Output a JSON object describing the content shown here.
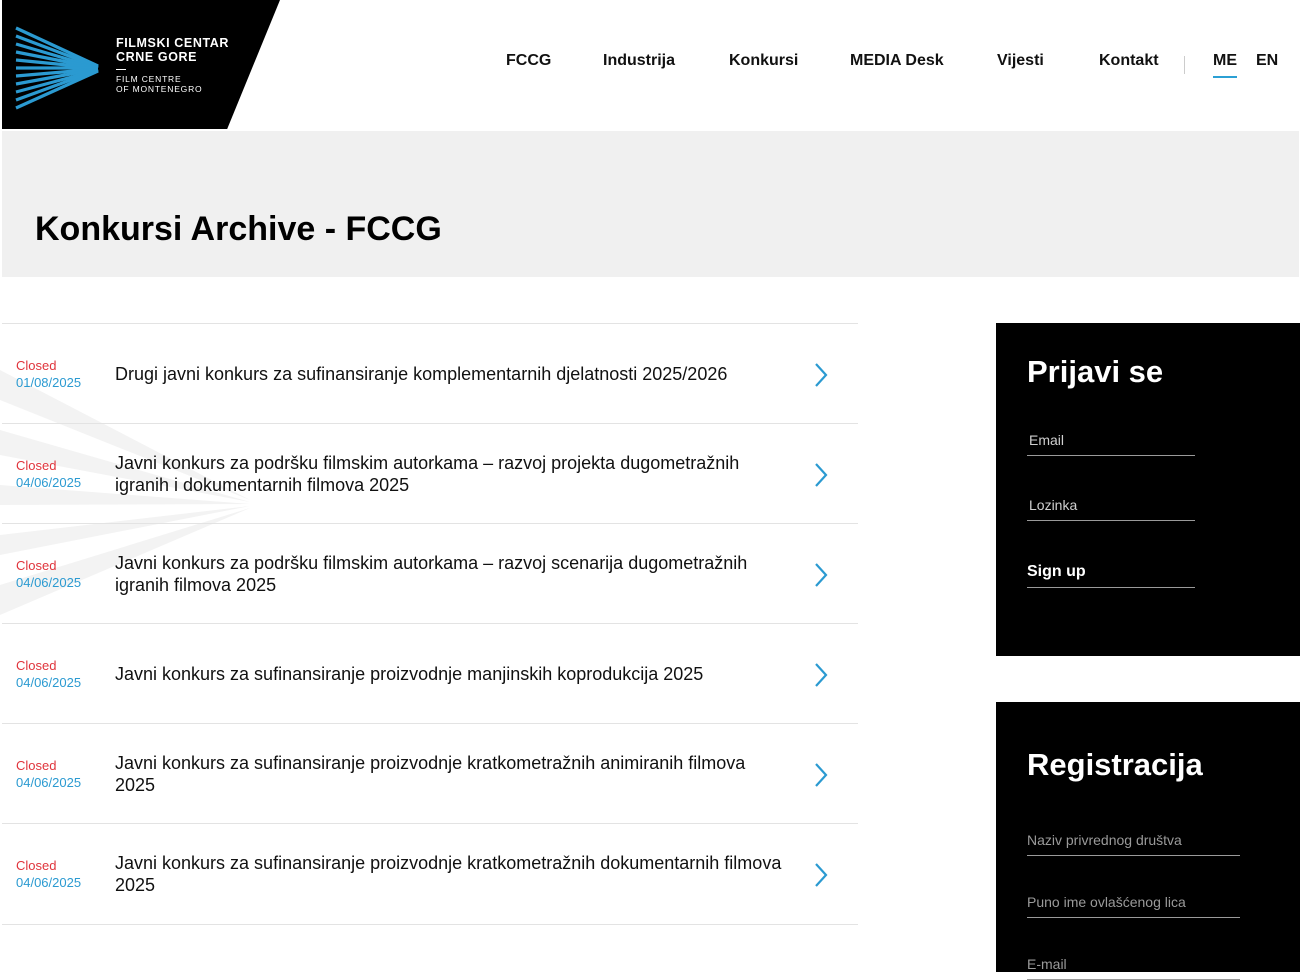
{
  "header": {
    "logo": {
      "line1": "FILMSKI CENTAR",
      "line2": "CRNE GORE",
      "line3": "FILM CENTRE",
      "line4": "OF MONTENEGRO"
    },
    "nav": [
      "FCCG",
      "Industrija",
      "Konkursi",
      "MEDIA Desk",
      "Vijesti",
      "Kontakt"
    ],
    "languages": [
      {
        "code": "ME",
        "active": true
      },
      {
        "code": "EN",
        "active": false
      }
    ]
  },
  "page_title": "Konkursi Archive - FCCG",
  "calls": [
    {
      "status": "Closed",
      "date": "01/08/2025",
      "title": "Drugi javni konkurs za sufinansiranje komplementarnih djelatnosti 2025/2026"
    },
    {
      "status": "Closed",
      "date": "04/06/2025",
      "title": "Javni konkurs za podršku filmskim autorkama – razvoj projekta dugometražnih igranih i dokumentarnih filmova 2025"
    },
    {
      "status": "Closed",
      "date": "04/06/2025",
      "title": "Javni konkurs za podršku filmskim autorkama – razvoj scenarija dugometražnih igranih filmova 2025"
    },
    {
      "status": "Closed",
      "date": "04/06/2025",
      "title": "Javni konkurs za sufinansiranje proizvodnje manjinskih koprodukcija 2025"
    },
    {
      "status": "Closed",
      "date": "04/06/2025",
      "title": "Javni konkurs za sufinansiranje proizvodnje kratkometražnih animiranih filmova 2025"
    },
    {
      "status": "Closed",
      "date": "04/06/2025",
      "title": "Javni konkurs za sufinansiranje proizvodnje kratkometražnih dokumentarnih filmova 2025"
    }
  ],
  "login": {
    "title": "Prijavi se",
    "email_placeholder": "Email",
    "password_placeholder": "Lozinka",
    "submit": "Sign up"
  },
  "register": {
    "title": "Registracija",
    "company_placeholder": "Naziv privrednog društva",
    "name_placeholder": "Puno ime ovlašćenog lica",
    "email_placeholder": "E-mail"
  },
  "colors": {
    "accent": "#2ba0d4",
    "closed": "#e0343c",
    "date": "#2b9ad1",
    "sidebar_bg": "#000000",
    "title_band": "#f0f0f0"
  }
}
